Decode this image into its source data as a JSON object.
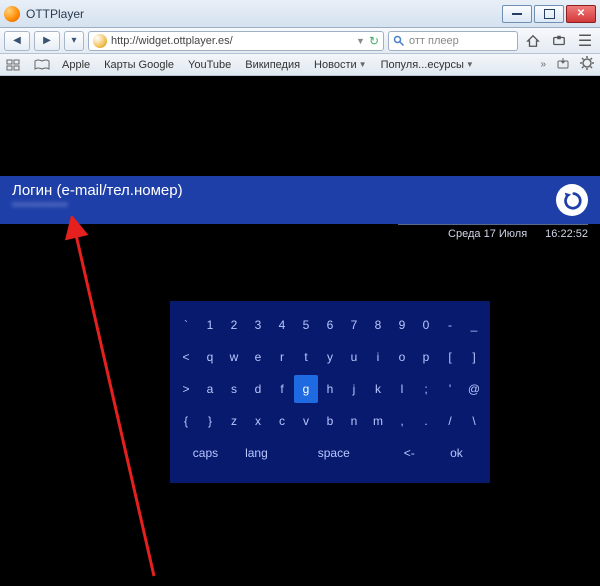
{
  "window": {
    "title": "OTTPlayer"
  },
  "nav": {
    "url": "http://widget.ottplayer.es/",
    "search_placeholder": "отт плеер"
  },
  "bookmarks": {
    "items": [
      {
        "label": "Apple"
      },
      {
        "label": "Карты Google"
      },
      {
        "label": "YouTube"
      },
      {
        "label": "Википедия"
      },
      {
        "label": "Новости",
        "dropdown": true
      },
      {
        "label": "Популя...есурсы",
        "dropdown": true
      }
    ]
  },
  "login": {
    "label": "Логин (e-mail/тел.номер)",
    "value": "*************"
  },
  "status": {
    "date": "Среда 17 Июля",
    "time": "16:22:52"
  },
  "osk": {
    "row1": [
      "`",
      "1",
      "2",
      "3",
      "4",
      "5",
      "6",
      "7",
      "8",
      "9",
      "0",
      "-",
      "_"
    ],
    "row2": [
      "<",
      "q",
      "w",
      "e",
      "r",
      "t",
      "y",
      "u",
      "i",
      "o",
      "p",
      "[",
      "]"
    ],
    "row3": [
      ">",
      "a",
      "s",
      "d",
      "f",
      "g",
      "h",
      "j",
      "k",
      "l",
      ";",
      "'",
      "@"
    ],
    "row4": [
      "{",
      "}",
      "z",
      "x",
      "c",
      "v",
      "b",
      "n",
      "m",
      ",",
      ".",
      "/",
      "\\"
    ],
    "fn": {
      "caps": "caps",
      "lang": "lang",
      "space": "space",
      "back": "<-",
      "ok": "ok"
    },
    "selected": "g"
  }
}
